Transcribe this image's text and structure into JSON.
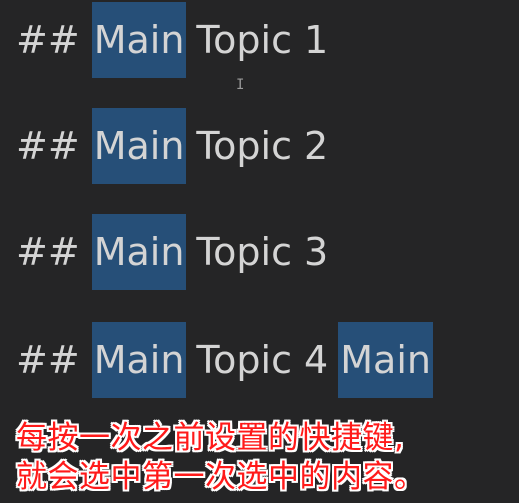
{
  "editor": {
    "lines": [
      {
        "hash": "##",
        "highlight": "Main",
        "rest": "Topic 1"
      },
      {
        "hash": "##",
        "highlight": "Main",
        "rest": "Topic 2"
      },
      {
        "hash": "##",
        "highlight": "Main",
        "rest": "Topic 3"
      },
      {
        "hash": "##",
        "highlight": "Main",
        "rest": "Topic 4",
        "trailing_highlight": "Main"
      }
    ]
  },
  "subtitles": [
    "每按一次之前设置的快捷键,",
    "就会选中第一次选中的内容。"
  ],
  "colors": {
    "background": "#252526",
    "selection": "#264f78",
    "text": "#d4d4d4",
    "subtitle": "#ff1a1a"
  }
}
